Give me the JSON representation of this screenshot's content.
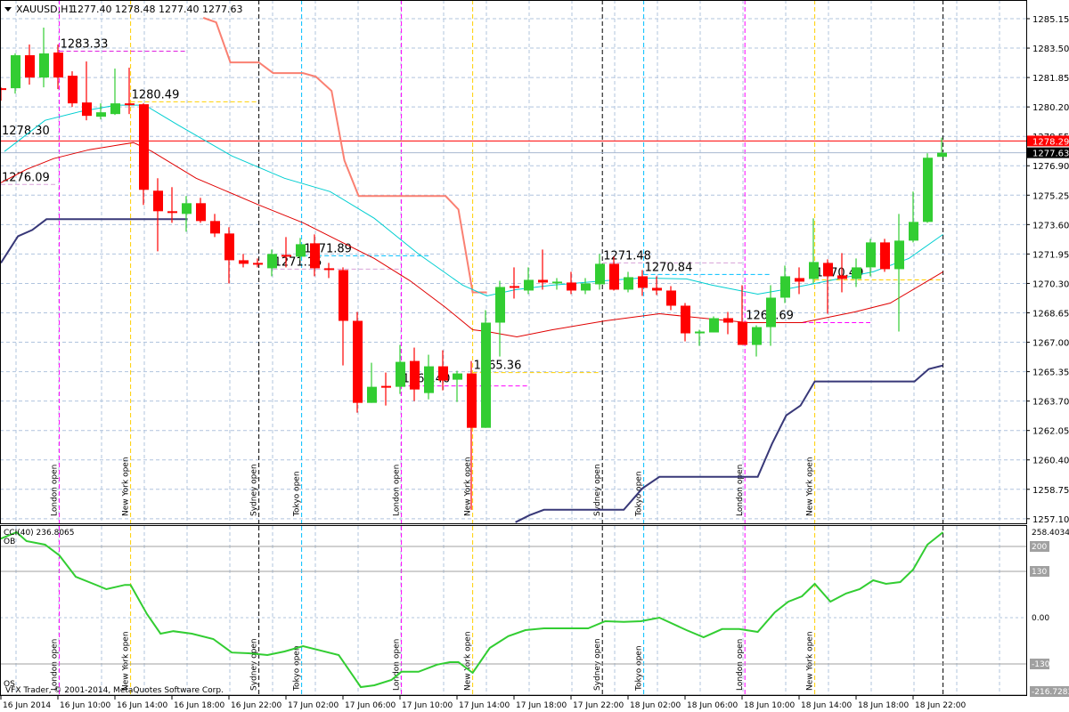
{
  "header": {
    "symbol": "XAUUSD,H1",
    "ohlc": "1277.40 1278.48 1277.40 1277.63"
  },
  "indicator_label": "CCI(40) 236.8065",
  "ob_label": "OB",
  "os_label": "OS",
  "copyright": "VFX Trader, © 2001-2014, MetaQuotes Software Corp.",
  "colors": {
    "bull": "#32cd32",
    "bear": "#ff0000",
    "grid": "#b0c4de",
    "upper_band": "#fa8072",
    "lower_band": "#383878",
    "fast_ma": "#00ced1",
    "slow_ma": "#e00000",
    "cci": "#32cd32"
  },
  "chart_data": {
    "type": "candlestick",
    "symbol": "XAUUSD",
    "timeframe": "H1",
    "price_ticks": [
      "1285.15",
      "1283.50",
      "1281.85",
      "1280.20",
      "1278.55",
      "1276.90",
      "1275.25",
      "1273.60",
      "1271.95",
      "1270.30",
      "1268.65",
      "1267.00",
      "1265.35",
      "1263.70",
      "1262.05",
      "1260.40",
      "1258.75",
      "1257.10"
    ],
    "ylim": [
      1257.1,
      1285.15
    ],
    "current_price": {
      "label": "1277.63",
      "value": 1277.63
    },
    "red_level": {
      "label": "1278.29",
      "value": 1278.29
    },
    "time_labels": [
      "16 Jun 2014",
      "16 Jun 10:00",
      "16 Jun 14:00",
      "16 Jun 18:00",
      "16 Jun 22:00",
      "17 Jun 02:00",
      "17 Jun 06:00",
      "17 Jun 10:00",
      "17 Jun 14:00",
      "17 Jun 18:00",
      "17 Jun 22:00",
      "18 Jun 02:00",
      "18 Jun 06:00",
      "18 Jun 10:00",
      "18 Jun 14:00",
      "18 Jun 18:00",
      "18 Jun 22:00"
    ],
    "candles": [
      [
        1281.25,
        1281.3,
        1280.55,
        1281.15
      ],
      [
        1281.25,
        1283.2,
        1280.95,
        1283.1
      ],
      [
        1283.1,
        1283.7,
        1281.45,
        1281.85
      ],
      [
        1281.85,
        1284.65,
        1281.3,
        1283.2
      ],
      [
        1283.25,
        1283.7,
        1281.2,
        1281.85
      ],
      [
        1281.95,
        1282.2,
        1280.2,
        1280.4
      ],
      [
        1280.45,
        1282.75,
        1279.45,
        1279.7
      ],
      [
        1279.65,
        1280.4,
        1279.5,
        1279.9
      ],
      [
        1279.8,
        1282.35,
        1279.75,
        1280.4
      ],
      [
        1280.4,
        1282.4,
        1279.8,
        1280.3
      ],
      [
        1280.35,
        1280.4,
        1274.7,
        1275.55
      ],
      [
        1275.5,
        1276.2,
        1272.1,
        1274.35
      ],
      [
        1274.35,
        1275.7,
        1273.7,
        1274.25
      ],
      [
        1274.2,
        1275.2,
        1273.2,
        1274.8
      ],
      [
        1274.8,
        1275.1,
        1273.7,
        1273.8
      ],
      [
        1273.8,
        1274.2,
        1272.9,
        1273.1
      ],
      [
        1273.1,
        1273.45,
        1270.3,
        1271.6
      ],
      [
        1271.6,
        1271.95,
        1271.2,
        1271.4
      ],
      [
        1271.45,
        1271.7,
        1271.2,
        1271.35
      ],
      [
        1271.15,
        1272.2,
        1270.7,
        1271.95
      ],
      [
        1271.9,
        1272.9,
        1271.2,
        1271.8
      ],
      [
        1271.8,
        1272.85,
        1271.6,
        1272.5
      ],
      [
        1272.55,
        1273.05,
        1270.7,
        1271.15
      ],
      [
        1271.15,
        1271.45,
        1270.6,
        1271.05
      ],
      [
        1271.05,
        1271.2,
        1265.7,
        1268.2
      ],
      [
        1268.2,
        1268.7,
        1263.05,
        1263.6
      ],
      [
        1263.6,
        1265.85,
        1263.6,
        1264.5
      ],
      [
        1264.55,
        1265.3,
        1263.45,
        1264.5
      ],
      [
        1264.5,
        1266.85,
        1264.1,
        1265.9
      ],
      [
        1265.95,
        1266.7,
        1263.7,
        1264.35
      ],
      [
        1264.15,
        1266.3,
        1263.8,
        1265.65
      ],
      [
        1265.65,
        1266.55,
        1264.3,
        1264.85
      ],
      [
        1264.9,
        1265.4,
        1263.65,
        1265.25
      ],
      [
        1265.25,
        1265.95,
        1257.6,
        1262.2
      ],
      [
        1262.2,
        1268.8,
        1262.2,
        1268.1
      ],
      [
        1268.1,
        1270.45,
        1266.2,
        1270.1
      ],
      [
        1270.15,
        1271.2,
        1269.45,
        1270.05
      ],
      [
        1269.9,
        1271.2,
        1269.7,
        1270.5
      ],
      [
        1270.5,
        1272.2,
        1269.95,
        1270.35
      ],
      [
        1270.3,
        1270.6,
        1269.95,
        1270.4
      ],
      [
        1270.35,
        1270.95,
        1269.7,
        1269.9
      ],
      [
        1269.9,
        1270.6,
        1269.7,
        1270.3
      ],
      [
        1270.25,
        1271.95,
        1269.95,
        1271.4
      ],
      [
        1271.4,
        1271.8,
        1269.9,
        1269.95
      ],
      [
        1269.95,
        1270.95,
        1269.8,
        1270.65
      ],
      [
        1270.7,
        1271.05,
        1269.6,
        1270.05
      ],
      [
        1270.05,
        1270.7,
        1269.65,
        1269.9
      ],
      [
        1269.9,
        1270.15,
        1268.8,
        1269.05
      ],
      [
        1269.05,
        1269.2,
        1267.05,
        1267.5
      ],
      [
        1267.5,
        1267.7,
        1266.8,
        1267.6
      ],
      [
        1267.55,
        1268.45,
        1267.55,
        1268.35
      ],
      [
        1268.35,
        1268.7,
        1267.45,
        1268.1
      ],
      [
        1268.15,
        1270.2,
        1266.85,
        1266.85
      ],
      [
        1266.85,
        1267.95,
        1266.2,
        1267.85
      ],
      [
        1267.85,
        1270.2,
        1266.8,
        1269.5
      ],
      [
        1269.5,
        1271.3,
        1269.2,
        1270.7
      ],
      [
        1270.6,
        1271.2,
        1269.7,
        1270.4
      ],
      [
        1270.55,
        1273.95,
        1270.3,
        1271.5
      ],
      [
        1271.45,
        1271.65,
        1268.6,
        1270.7
      ],
      [
        1270.75,
        1272.0,
        1269.8,
        1270.55
      ],
      [
        1270.55,
        1271.7,
        1270.1,
        1271.2
      ],
      [
        1271.2,
        1272.8,
        1270.7,
        1272.6
      ],
      [
        1272.6,
        1272.8,
        1270.95,
        1271.1
      ],
      [
        1271.1,
        1274.2,
        1267.6,
        1272.7
      ],
      [
        1272.7,
        1275.45,
        1272.6,
        1273.75
      ],
      [
        1273.75,
        1277.6,
        1273.7,
        1277.35
      ],
      [
        1277.4,
        1278.48,
        1277.4,
        1277.63
      ]
    ],
    "upper_band": [
      [
        14.2,
        1285.2
      ],
      [
        15.1,
        1284.95
      ],
      [
        16.1,
        1282.7
      ],
      [
        18.1,
        1282.7
      ],
      [
        19.1,
        1282.1
      ],
      [
        21.2,
        1282.1
      ],
      [
        22.1,
        1281.9
      ],
      [
        23.2,
        1281.1
      ],
      [
        24.1,
        1277.2
      ],
      [
        25.1,
        1275.2
      ],
      [
        31.2,
        1275.2
      ],
      [
        32.1,
        1274.45
      ],
      [
        33.1,
        1269.8
      ],
      [
        34.1,
        1269.8
      ]
    ],
    "lower_band": [
      [
        [
          0,
          1271.45
        ],
        [
          1.2,
          1272.95
        ],
        [
          2.2,
          1273.3
        ],
        [
          3.2,
          1273.9
        ],
        [
          13.1,
          1273.9
        ]
      ],
      [
        [
          36.1,
          1256.9
        ],
        [
          37.1,
          1257.3
        ],
        [
          38.1,
          1257.6
        ],
        [
          43.7,
          1257.6
        ],
        [
          45,
          1258.8
        ],
        [
          46.2,
          1259.45
        ],
        [
          53.1,
          1259.45
        ],
        [
          54.1,
          1261.3
        ],
        [
          55.1,
          1262.9
        ],
        [
          56.1,
          1263.45
        ],
        [
          57.1,
          1264.8
        ],
        [
          64.1,
          1264.8
        ],
        [
          65.1,
          1265.5
        ],
        [
          66.1,
          1265.7
        ]
      ]
    ],
    "fast_ma": [
      [
        0.25,
        1277.7
      ],
      [
        3.1,
        1279.45
      ],
      [
        5.6,
        1279.95
      ],
      [
        8.1,
        1280.3
      ],
      [
        10.1,
        1280.3
      ],
      [
        12.4,
        1279.2
      ],
      [
        16.2,
        1277.45
      ],
      [
        19.9,
        1276.2
      ],
      [
        23.1,
        1275.45
      ],
      [
        26.2,
        1273.95
      ],
      [
        29.3,
        1271.95
      ],
      [
        32.4,
        1270.2
      ],
      [
        34.1,
        1269.6
      ],
      [
        36.1,
        1269.95
      ],
      [
        38.7,
        1270.2
      ],
      [
        42.4,
        1270.45
      ],
      [
        44.9,
        1270.6
      ],
      [
        48.1,
        1270.55
      ],
      [
        49.9,
        1270.2
      ],
      [
        53.1,
        1269.7
      ],
      [
        54.9,
        1269.95
      ],
      [
        58.1,
        1270.45
      ],
      [
        61.2,
        1270.95
      ],
      [
        63.7,
        1271.7
      ],
      [
        66.1,
        1273.05
      ]
    ],
    "slow_ma": [
      [
        0,
        1275.95
      ],
      [
        1.8,
        1276.7
      ],
      [
        3.7,
        1277.3
      ],
      [
        6.2,
        1277.8
      ],
      [
        9.3,
        1278.2
      ],
      [
        10.6,
        1277.7
      ],
      [
        13.7,
        1276.2
      ],
      [
        18.1,
        1274.7
      ],
      [
        21.2,
        1273.7
      ],
      [
        23.7,
        1272.7
      ],
      [
        26.2,
        1271.7
      ],
      [
        28.7,
        1270.45
      ],
      [
        31.2,
        1268.95
      ],
      [
        33.1,
        1267.7
      ],
      [
        34.1,
        1267.6
      ],
      [
        36.2,
        1267.3
      ],
      [
        38.7,
        1267.7
      ],
      [
        42.4,
        1268.2
      ],
      [
        46.2,
        1268.6
      ],
      [
        49.9,
        1268.3
      ],
      [
        52.4,
        1268.1
      ],
      [
        56.2,
        1268.1
      ],
      [
        59.9,
        1268.7
      ],
      [
        62.4,
        1269.2
      ],
      [
        66.1,
        1270.95
      ]
    ],
    "level_labels": [
      {
        "text": "1283.33",
        "price": 1283.33,
        "start": 4.1,
        "end": 13,
        "color": "#e020e0"
      },
      {
        "text": "1280.49",
        "price": 1280.49,
        "start": 9.1,
        "end": 18,
        "color": "#ffd000"
      },
      {
        "text": "1278.30",
        "price": 1278.45,
        "start": 0,
        "end": 0,
        "color": "none"
      },
      {
        "text": "1276.09",
        "price": 1275.85,
        "start": 0,
        "end": 4,
        "color": "#d8a0d8"
      },
      {
        "text": "1271.89",
        "price": 1271.85,
        "start": 21.2,
        "end": 30,
        "color": "#00bfff"
      },
      {
        "text": "1271.15",
        "price": 1271.1,
        "start": 19.1,
        "end": 28,
        "color": "#d8a0d8"
      },
      {
        "text": "1264.40",
        "price": 1264.55,
        "start": 28.1,
        "end": 37,
        "color": "#ff00ff"
      },
      {
        "text": "1265.36",
        "price": 1265.3,
        "start": 33.1,
        "end": 42,
        "color": "#ffd000"
      },
      {
        "text": "1271.48",
        "price": 1271.45,
        "start": 42.2,
        "end": 52,
        "color": "#d8a0d8"
      },
      {
        "text": "1270.84",
        "price": 1270.8,
        "start": 45.1,
        "end": 54,
        "color": "#00bfff"
      },
      {
        "text": "1268.69",
        "price": 1268.1,
        "start": 52.2,
        "end": 61,
        "color": "#ff00ff"
      },
      {
        "text": "1270.49",
        "price": 1270.5,
        "start": 57.1,
        "end": 66,
        "color": "#ffd000"
      }
    ],
    "sessions": [
      {
        "label": "London open",
        "bar": 4.1,
        "color": "#ff00ff"
      },
      {
        "label": "New York open",
        "bar": 9.1,
        "color": "#ffd000"
      },
      {
        "label": "Sydney open",
        "bar": 18.1,
        "color": "#000000"
      },
      {
        "label": "Tokyo open",
        "bar": 21.1,
        "color": "#00bfff"
      },
      {
        "label": "London open",
        "bar": 28.1,
        "color": "#ff00ff"
      },
      {
        "label": "New York open",
        "bar": 33.1,
        "color": "#ffd000"
      },
      {
        "label": "Sydney open",
        "bar": 42.2,
        "color": "#000000"
      },
      {
        "label": "Tokyo open",
        "bar": 45.1,
        "color": "#00bfff"
      },
      {
        "label": "London open",
        "bar": 52.2,
        "color": "#ff00ff"
      },
      {
        "label": "New York open",
        "bar": 57.1,
        "color": "#ffd000"
      }
    ],
    "cci": {
      "period": 40,
      "ticks": [
        {
          "label": "258.4034",
          "value": 258.4034,
          "boxed": false
        },
        {
          "label": "200",
          "value": 200,
          "boxed": true
        },
        {
          "label": "130",
          "value": 130,
          "boxed": true
        },
        {
          "label": "0.00",
          "value": 0,
          "boxed": false
        },
        {
          "label": "-130",
          "value": -130,
          "boxed": true
        },
        {
          "label": "-216.7283",
          "value": -216.7283,
          "boxed": true
        }
      ],
      "levels": [
        200,
        130,
        -130,
        -216.7283
      ],
      "values": [
        [
          0,
          222
        ],
        [
          1.1,
          240
        ],
        [
          1.8,
          215
        ],
        [
          3.1,
          205
        ],
        [
          4.1,
          175
        ],
        [
          5.25,
          115
        ],
        [
          6.8,
          90
        ],
        [
          7.4,
          80
        ],
        [
          8.7,
          92
        ],
        [
          9.1,
          92
        ],
        [
          10.25,
          10
        ],
        [
          11.2,
          -45
        ],
        [
          12.1,
          -38
        ],
        [
          13.4,
          -45
        ],
        [
          14.9,
          -60
        ],
        [
          16.2,
          -98
        ],
        [
          17.4,
          -100
        ],
        [
          18.7,
          -105
        ],
        [
          19.9,
          -95
        ],
        [
          21.2,
          -80
        ],
        [
          22.4,
          -92
        ],
        [
          23.7,
          -105
        ],
        [
          25.25,
          -195
        ],
        [
          26.2,
          -190
        ],
        [
          27.4,
          -175
        ],
        [
          28.1,
          -152
        ],
        [
          29.3,
          -152
        ],
        [
          30.6,
          -132
        ],
        [
          31.5,
          -125
        ],
        [
          32.1,
          -125
        ],
        [
          33.1,
          -155
        ],
        [
          34.3,
          -85
        ],
        [
          35.6,
          -52
        ],
        [
          36.8,
          -35
        ],
        [
          38.1,
          -30
        ],
        [
          41.2,
          -30
        ],
        [
          42.4,
          -10
        ],
        [
          43.7,
          -12
        ],
        [
          44.9,
          -10
        ],
        [
          46.2,
          0
        ],
        [
          48.1,
          -35
        ],
        [
          49.3,
          -55
        ],
        [
          50.6,
          -32
        ],
        [
          51.8,
          -32
        ],
        [
          53.1,
          -40
        ],
        [
          54.3,
          15
        ],
        [
          55.25,
          45
        ],
        [
          56.2,
          60
        ],
        [
          57.1,
          95
        ],
        [
          58.2,
          45
        ],
        [
          59.3,
          68
        ],
        [
          60.25,
          80
        ],
        [
          61.2,
          105
        ],
        [
          62.1,
          95
        ],
        [
          63.1,
          100
        ],
        [
          64,
          135
        ],
        [
          65,
          205
        ],
        [
          66.1,
          240
        ]
      ]
    }
  }
}
